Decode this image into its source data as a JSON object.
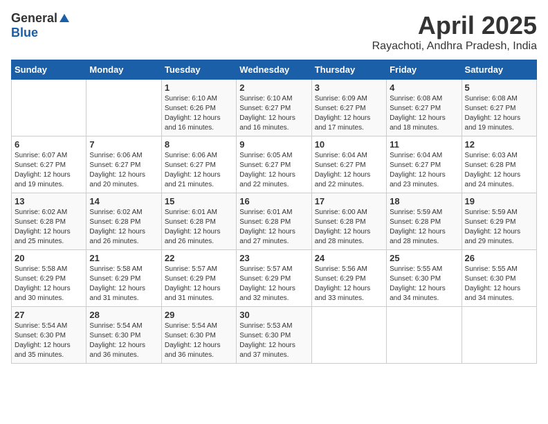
{
  "header": {
    "logo_general": "General",
    "logo_blue": "Blue",
    "month_title": "April 2025",
    "location": "Rayachoti, Andhra Pradesh, India"
  },
  "days_of_week": [
    "Sunday",
    "Monday",
    "Tuesday",
    "Wednesday",
    "Thursday",
    "Friday",
    "Saturday"
  ],
  "weeks": [
    [
      {
        "day": "",
        "sunrise": "",
        "sunset": "",
        "daylight": ""
      },
      {
        "day": "",
        "sunrise": "",
        "sunset": "",
        "daylight": ""
      },
      {
        "day": "1",
        "sunrise": "Sunrise: 6:10 AM",
        "sunset": "Sunset: 6:26 PM",
        "daylight": "Daylight: 12 hours and 16 minutes."
      },
      {
        "day": "2",
        "sunrise": "Sunrise: 6:10 AM",
        "sunset": "Sunset: 6:27 PM",
        "daylight": "Daylight: 12 hours and 16 minutes."
      },
      {
        "day": "3",
        "sunrise": "Sunrise: 6:09 AM",
        "sunset": "Sunset: 6:27 PM",
        "daylight": "Daylight: 12 hours and 17 minutes."
      },
      {
        "day": "4",
        "sunrise": "Sunrise: 6:08 AM",
        "sunset": "Sunset: 6:27 PM",
        "daylight": "Daylight: 12 hours and 18 minutes."
      },
      {
        "day": "5",
        "sunrise": "Sunrise: 6:08 AM",
        "sunset": "Sunset: 6:27 PM",
        "daylight": "Daylight: 12 hours and 19 minutes."
      }
    ],
    [
      {
        "day": "6",
        "sunrise": "Sunrise: 6:07 AM",
        "sunset": "Sunset: 6:27 PM",
        "daylight": "Daylight: 12 hours and 19 minutes."
      },
      {
        "day": "7",
        "sunrise": "Sunrise: 6:06 AM",
        "sunset": "Sunset: 6:27 PM",
        "daylight": "Daylight: 12 hours and 20 minutes."
      },
      {
        "day": "8",
        "sunrise": "Sunrise: 6:06 AM",
        "sunset": "Sunset: 6:27 PM",
        "daylight": "Daylight: 12 hours and 21 minutes."
      },
      {
        "day": "9",
        "sunrise": "Sunrise: 6:05 AM",
        "sunset": "Sunset: 6:27 PM",
        "daylight": "Daylight: 12 hours and 22 minutes."
      },
      {
        "day": "10",
        "sunrise": "Sunrise: 6:04 AM",
        "sunset": "Sunset: 6:27 PM",
        "daylight": "Daylight: 12 hours and 22 minutes."
      },
      {
        "day": "11",
        "sunrise": "Sunrise: 6:04 AM",
        "sunset": "Sunset: 6:27 PM",
        "daylight": "Daylight: 12 hours and 23 minutes."
      },
      {
        "day": "12",
        "sunrise": "Sunrise: 6:03 AM",
        "sunset": "Sunset: 6:28 PM",
        "daylight": "Daylight: 12 hours and 24 minutes."
      }
    ],
    [
      {
        "day": "13",
        "sunrise": "Sunrise: 6:02 AM",
        "sunset": "Sunset: 6:28 PM",
        "daylight": "Daylight: 12 hours and 25 minutes."
      },
      {
        "day": "14",
        "sunrise": "Sunrise: 6:02 AM",
        "sunset": "Sunset: 6:28 PM",
        "daylight": "Daylight: 12 hours and 26 minutes."
      },
      {
        "day": "15",
        "sunrise": "Sunrise: 6:01 AM",
        "sunset": "Sunset: 6:28 PM",
        "daylight": "Daylight: 12 hours and 26 minutes."
      },
      {
        "day": "16",
        "sunrise": "Sunrise: 6:01 AM",
        "sunset": "Sunset: 6:28 PM",
        "daylight": "Daylight: 12 hours and 27 minutes."
      },
      {
        "day": "17",
        "sunrise": "Sunrise: 6:00 AM",
        "sunset": "Sunset: 6:28 PM",
        "daylight": "Daylight: 12 hours and 28 minutes."
      },
      {
        "day": "18",
        "sunrise": "Sunrise: 5:59 AM",
        "sunset": "Sunset: 6:28 PM",
        "daylight": "Daylight: 12 hours and 28 minutes."
      },
      {
        "day": "19",
        "sunrise": "Sunrise: 5:59 AM",
        "sunset": "Sunset: 6:29 PM",
        "daylight": "Daylight: 12 hours and 29 minutes."
      }
    ],
    [
      {
        "day": "20",
        "sunrise": "Sunrise: 5:58 AM",
        "sunset": "Sunset: 6:29 PM",
        "daylight": "Daylight: 12 hours and 30 minutes."
      },
      {
        "day": "21",
        "sunrise": "Sunrise: 5:58 AM",
        "sunset": "Sunset: 6:29 PM",
        "daylight": "Daylight: 12 hours and 31 minutes."
      },
      {
        "day": "22",
        "sunrise": "Sunrise: 5:57 AM",
        "sunset": "Sunset: 6:29 PM",
        "daylight": "Daylight: 12 hours and 31 minutes."
      },
      {
        "day": "23",
        "sunrise": "Sunrise: 5:57 AM",
        "sunset": "Sunset: 6:29 PM",
        "daylight": "Daylight: 12 hours and 32 minutes."
      },
      {
        "day": "24",
        "sunrise": "Sunrise: 5:56 AM",
        "sunset": "Sunset: 6:29 PM",
        "daylight": "Daylight: 12 hours and 33 minutes."
      },
      {
        "day": "25",
        "sunrise": "Sunrise: 5:55 AM",
        "sunset": "Sunset: 6:30 PM",
        "daylight": "Daylight: 12 hours and 34 minutes."
      },
      {
        "day": "26",
        "sunrise": "Sunrise: 5:55 AM",
        "sunset": "Sunset: 6:30 PM",
        "daylight": "Daylight: 12 hours and 34 minutes."
      }
    ],
    [
      {
        "day": "27",
        "sunrise": "Sunrise: 5:54 AM",
        "sunset": "Sunset: 6:30 PM",
        "daylight": "Daylight: 12 hours and 35 minutes."
      },
      {
        "day": "28",
        "sunrise": "Sunrise: 5:54 AM",
        "sunset": "Sunset: 6:30 PM",
        "daylight": "Daylight: 12 hours and 36 minutes."
      },
      {
        "day": "29",
        "sunrise": "Sunrise: 5:54 AM",
        "sunset": "Sunset: 6:30 PM",
        "daylight": "Daylight: 12 hours and 36 minutes."
      },
      {
        "day": "30",
        "sunrise": "Sunrise: 5:53 AM",
        "sunset": "Sunset: 6:30 PM",
        "daylight": "Daylight: 12 hours and 37 minutes."
      },
      {
        "day": "",
        "sunrise": "",
        "sunset": "",
        "daylight": ""
      },
      {
        "day": "",
        "sunrise": "",
        "sunset": "",
        "daylight": ""
      },
      {
        "day": "",
        "sunrise": "",
        "sunset": "",
        "daylight": ""
      }
    ]
  ]
}
